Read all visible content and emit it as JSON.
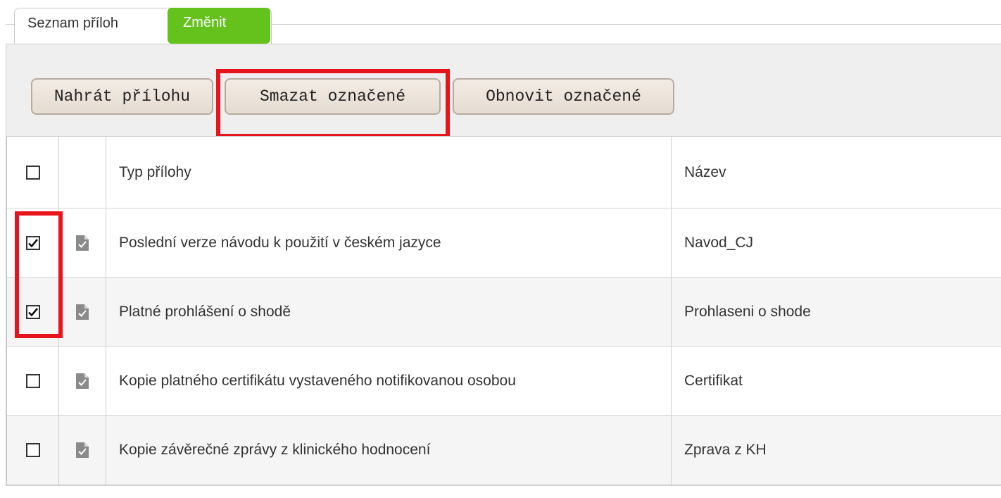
{
  "tabs": {
    "list_label": "Seznam příloh",
    "edit_label": "Změnit",
    "accent": "#65c21c"
  },
  "toolbar": {
    "upload_label": "Nahrát přílohu",
    "delete_label": "Smazat označené",
    "restore_label": "Obnovit označené"
  },
  "highlight_color": "#e8141c",
  "table": {
    "headers": {
      "type": "Typ přílohy",
      "name": "Název"
    },
    "rows": [
      {
        "checked": true,
        "icon": "document-check-icon",
        "type": "Poslední verze návodu k použití v českém jazyce",
        "name": "Navod_CJ"
      },
      {
        "checked": true,
        "icon": "document-check-icon",
        "type": "Platné prohlášení o shodě",
        "name": "Prohlaseni o shode"
      },
      {
        "checked": false,
        "icon": "document-check-icon",
        "type": "Kopie platného certifikátu vystaveného notifikovanou osobou",
        "name": "Certifikat"
      },
      {
        "checked": false,
        "icon": "document-check-icon",
        "type": "Kopie závěrečné zprávy z klinického hodnocení",
        "name": "Zprava z KH"
      }
    ]
  }
}
